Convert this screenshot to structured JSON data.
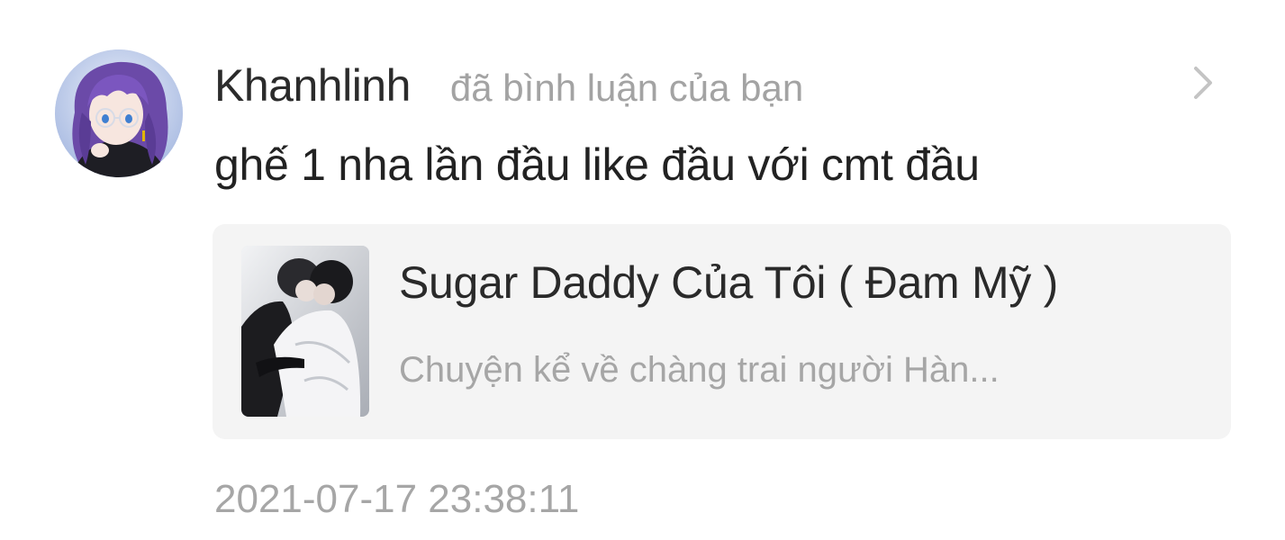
{
  "notification": {
    "username": "Khanhlinh",
    "action_text": "đã bình luận của bạn",
    "comment": "ghế 1 nha lần đầu like đầu với cmt đầu",
    "timestamp": "2021-07-17 23:38:11",
    "avatar_icon": "anime-girl-avatar",
    "chevron_icon": "chevron-right-icon"
  },
  "story_card": {
    "title": "Sugar Daddy Của Tôi ( Đam Mỹ )",
    "description": "Chuyện kể về chàng trai người Hàn...",
    "cover_icon": "story-cover-image"
  },
  "colors": {
    "primary_text": "#2b2b2b",
    "secondary_text": "#a3a3a3",
    "card_background": "#f4f4f4"
  }
}
